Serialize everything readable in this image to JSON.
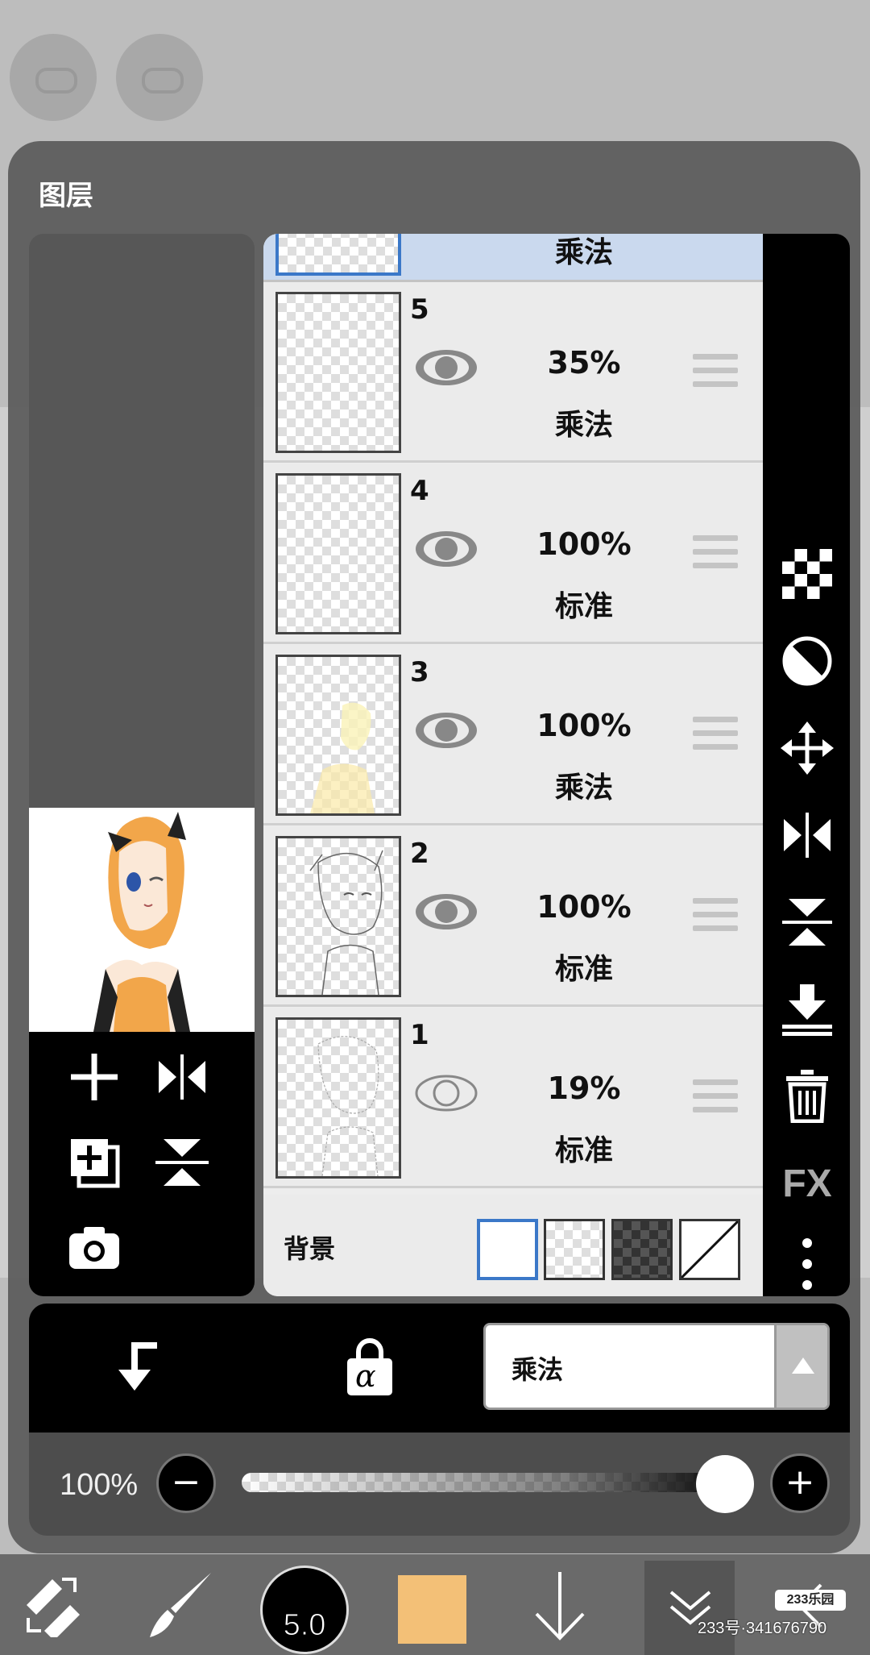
{
  "dialog": {
    "title": "图层"
  },
  "layers": [
    {
      "number": "",
      "opacity": "",
      "blend": "乘法",
      "visible": true,
      "selected": true
    },
    {
      "number": "5",
      "opacity": "35%",
      "blend": "乘法",
      "visible": true
    },
    {
      "number": "4",
      "opacity": "100%",
      "blend": "标准",
      "visible": true
    },
    {
      "number": "3",
      "opacity": "100%",
      "blend": "乘法",
      "visible": true
    },
    {
      "number": "2",
      "opacity": "100%",
      "blend": "标准",
      "visible": true
    },
    {
      "number": "1",
      "opacity": "19%",
      "blend": "标准",
      "visible": false
    }
  ],
  "background": {
    "label": "背景",
    "options": [
      "white",
      "checker",
      "dark-checker",
      "none"
    ],
    "selected": "white"
  },
  "side_tools": {
    "fx_label": "FX",
    "icons": [
      "checker-icon",
      "invert-icon",
      "move-icon",
      "flip-horizontal-icon",
      "flip-vertical-icon",
      "merge-down-icon",
      "trash-icon",
      "fx-icon",
      "more-icon"
    ]
  },
  "preview_tools": {
    "icons": [
      "add-layer-icon",
      "flip-horizontal-icon",
      "duplicate-layer-icon",
      "flip-vertical-icon",
      "camera-icon"
    ]
  },
  "action_bar": {
    "clip_icon": "clip-arrow-icon",
    "lock_icon": "alpha-lock-icon",
    "lock_symbol": "α",
    "blend_mode": "乘法"
  },
  "opacity_bar": {
    "value_label": "100%",
    "minus": "−",
    "plus": "+",
    "level": 1.0
  },
  "toolbar": {
    "brush_size": "5.0",
    "color": "#f3c077",
    "icons": [
      "swap-tools-icon",
      "brush-icon",
      "brush-size-icon",
      "color-icon",
      "down-arrow-icon",
      "collapse-icon",
      "back-icon"
    ]
  },
  "watermark": {
    "logo": "233乐园",
    "id_text": "233号·341676790"
  },
  "colors": {
    "accent": "#3b78c8",
    "selected_row": "#cad9ee",
    "panel": "#5a5a5a"
  }
}
